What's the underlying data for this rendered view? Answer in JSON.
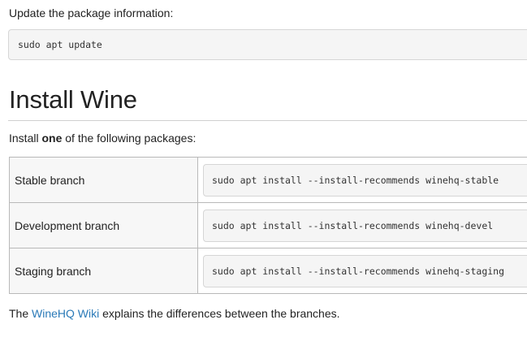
{
  "intro_text": "Update the package information:",
  "update_command": "sudo apt update",
  "section_title": "Install Wine",
  "install_prefix": "Install ",
  "install_bold": "one",
  "install_suffix": " of the following packages:",
  "branches": [
    {
      "label": "Stable branch",
      "command": "sudo apt install --install-recommends winehq-stable"
    },
    {
      "label": "Development branch",
      "command": "sudo apt install --install-recommends winehq-devel"
    },
    {
      "label": "Staging branch",
      "command": "sudo apt install --install-recommends winehq-staging"
    }
  ],
  "footer": {
    "prefix": "The ",
    "link": "WineHQ Wiki",
    "suffix": " explains the differences between the branches."
  },
  "colors": {
    "link": "#2a7ab8",
    "code_bg": "#f5f5f5",
    "label_bg": "#f7f7f7"
  }
}
